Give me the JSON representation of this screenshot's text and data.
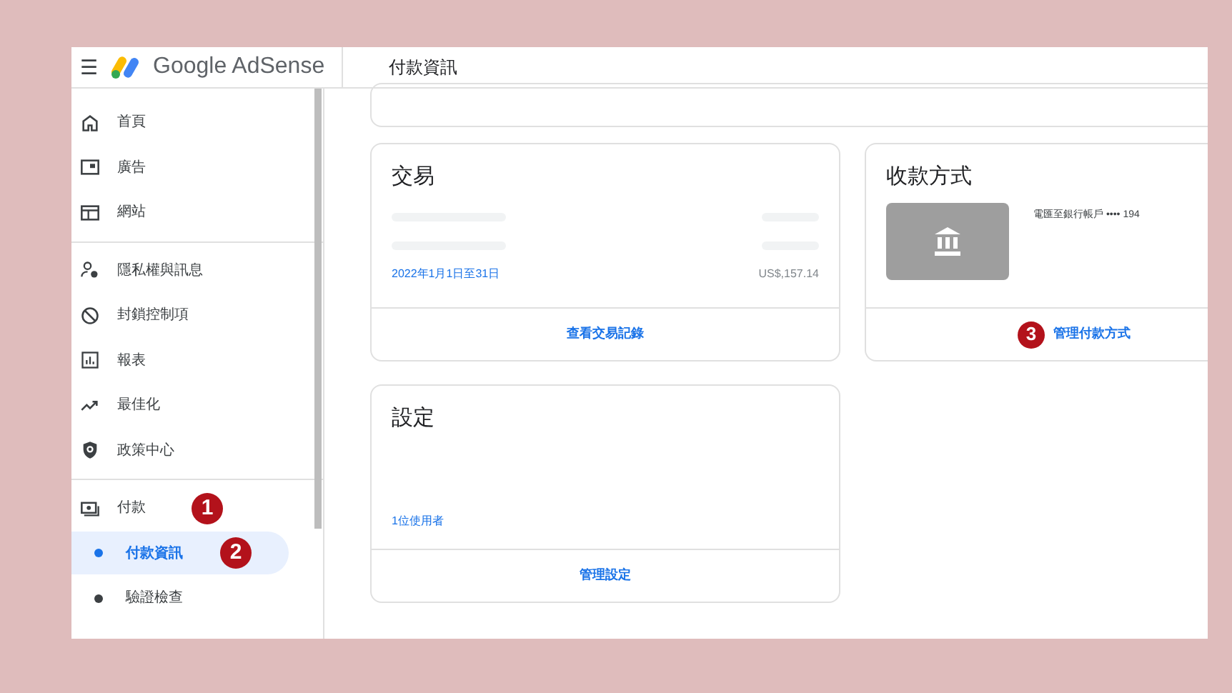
{
  "header": {
    "menu_icon": "☰",
    "product": "Google AdSense",
    "page_title": "付款資訊"
  },
  "sidebar": {
    "items": [
      {
        "label": "首頁",
        "selected": false
      },
      {
        "label": "廣告",
        "selected": false
      },
      {
        "label": "網站",
        "selected": false
      },
      {
        "label": "隱私權與訊息",
        "selected": false
      },
      {
        "label": "封鎖控制項",
        "selected": false
      },
      {
        "label": "報表",
        "selected": false
      },
      {
        "label": "最佳化",
        "selected": false
      },
      {
        "label": "政策中心",
        "selected": false
      },
      {
        "label": "付款",
        "selected": false,
        "marker": "1",
        "children": [
          {
            "label": "付款資訊",
            "selected": true,
            "marker": "2"
          },
          {
            "label": "驗證檢查",
            "selected": false
          }
        ]
      }
    ]
  },
  "transactions": {
    "title": "交易",
    "rows": [
      {
        "kind": "redacted"
      },
      {
        "kind": "redacted"
      },
      {
        "kind": "entry",
        "period": "2022年1月1日至31日",
        "amount": "US$,157.14"
      }
    ],
    "link": "查看交易記錄"
  },
  "payment_method": {
    "title": "收款方式",
    "account": "電匯至銀行帳戶 •••• 194",
    "link": "管理付款方式",
    "marker": "3"
  },
  "settings": {
    "title": "設定",
    "users": "1位使用者",
    "link": "管理設定"
  }
}
